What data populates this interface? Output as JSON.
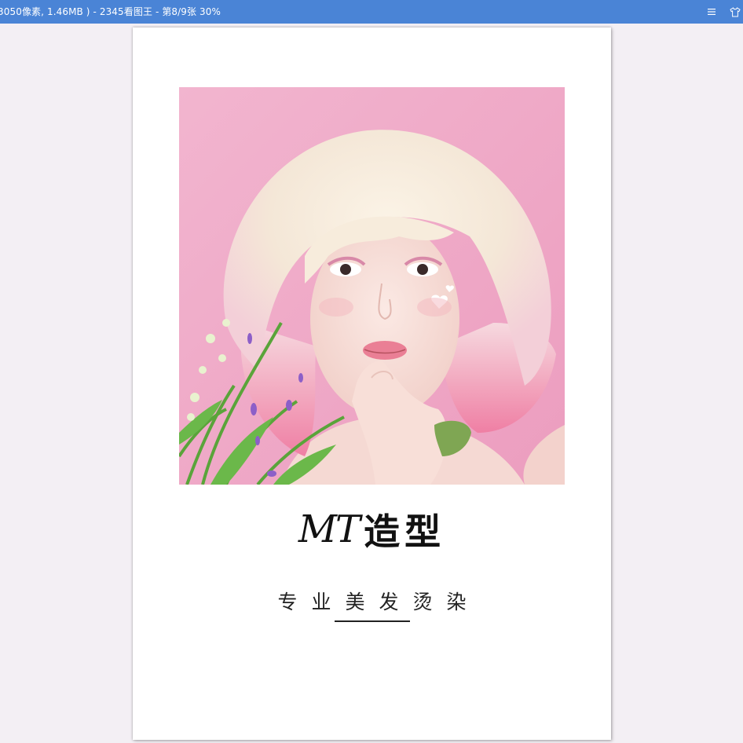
{
  "window": {
    "title": "3050像素, 1.46MB ) - 2345看图王 - 第8/9张 30%",
    "menu_icon": "menu-icon",
    "skin_icon": "skin-icon",
    "accent_color": "#4a84d6"
  },
  "viewer": {
    "background_color": "#f3eff4"
  },
  "poster": {
    "brand_latin": "MT",
    "brand_cn": "造型",
    "subtitle": "专业美发烫染",
    "photo": "pink-haired-woman-portrait"
  }
}
